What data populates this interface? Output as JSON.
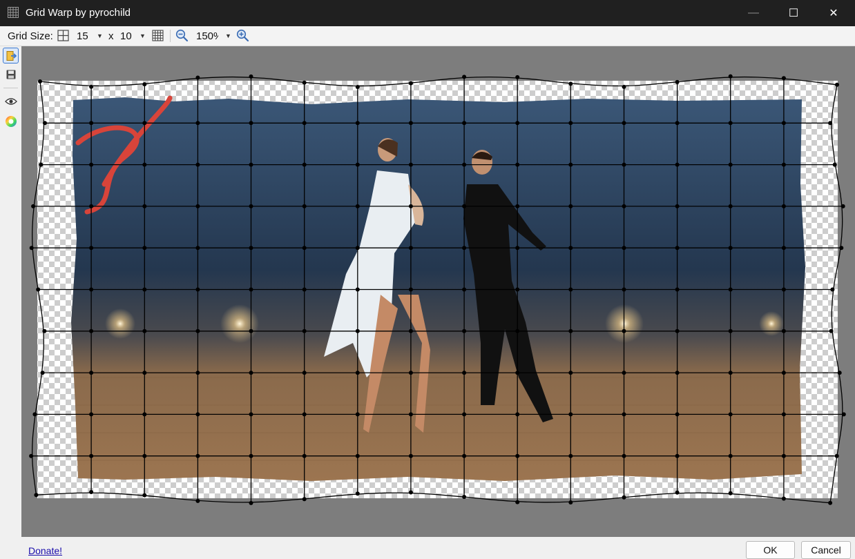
{
  "window": {
    "title": "Grid Warp by pyrochild",
    "minimize_glyph": "—",
    "maximize_glyph": "☐",
    "close_glyph": "✕"
  },
  "toolbar": {
    "grid_size_label": "Grid Size:",
    "columns_value": "15",
    "separator": "x",
    "rows_value": "10",
    "zoom_value": "150%"
  },
  "sidebar": {
    "tools": [
      "open-image-icon",
      "save-icon",
      "eye-icon",
      "color-wheel-icon"
    ]
  },
  "footer": {
    "donate_label": "Donate!",
    "ok_label": "OK",
    "cancel_label": "Cancel"
  },
  "colors": {
    "titlebar": "#202020",
    "canvas_bg": "#7d7d7d",
    "grid_line": "#000000",
    "link": "#1a0dab",
    "accent": "#3a78d0"
  }
}
